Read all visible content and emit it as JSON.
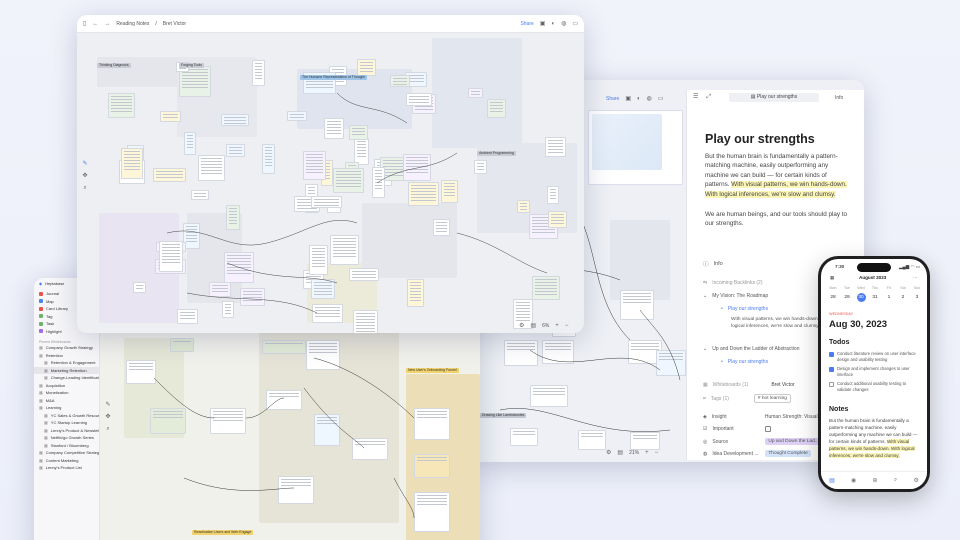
{
  "back_window": {
    "toolbar": {
      "share_label": "Share",
      "zoom": "21%"
    },
    "panel": {
      "toolbar_title": "Play our strengths",
      "info_tab": "Info",
      "title": "Play our strengths",
      "paragraph1": "But the human brain is fundamentally a pattern-matching machine, easily outperforming any machine we can build — for certain kinds of patterns.",
      "paragraph1_highlight": "With visual patterns, we win hands-down. With logical inferences, we're slow and clumsy.",
      "paragraph2": "We are human beings, and our tools should play to our strengths.",
      "info_label": "Info",
      "backlinks_label": "Incoming Backlinks (2)",
      "backlinks": [
        {
          "title": "My Vision: The Roadmap",
          "link": "Play our strengths",
          "text": "With visual patterns, we win hands-down. With logical inferences, we're slow and clumsy."
        },
        {
          "title": "Up and Down the Ladder of Abstraction",
          "link": "Play our strengths"
        }
      ],
      "whiteboards_label": "Whiteboards (1)",
      "author": "Bret Victor",
      "tags_label": "Tags (1)",
      "tag": "# hot learning",
      "props": [
        {
          "key": "Insight",
          "value": "Human Strength: Visual"
        },
        {
          "key": "Important",
          "value": ""
        },
        {
          "key": "Source",
          "value": "Up and Down the Lad..."
        },
        {
          "key": "Idea Development ...",
          "value": "Thought Complete"
        }
      ]
    },
    "canvas_labels": [
      "Drawing Like Lambdanotes"
    ]
  },
  "left_window": {
    "sidebar": {
      "title": "Heptabase",
      "items": [
        {
          "label": "Journal",
          "color": "#e8534a"
        },
        {
          "label": "Map",
          "color": "#4a86e8"
        },
        {
          "label": "Card Library",
          "color": "#e8534a"
        },
        {
          "label": "Tag",
          "color": "#6bb36b"
        },
        {
          "label": "Task",
          "color": "#6bb36b"
        },
        {
          "label": "Highlight",
          "color": "#a36be8"
        }
      ],
      "section_label": "Pinned Whiteboards",
      "boards": [
        {
          "label": "Company Growth Strategy",
          "level": 0
        },
        {
          "label": "Retention",
          "level": 0
        },
        {
          "label": "Retention & Engagement",
          "level": 1
        },
        {
          "label": "Marketing Retention",
          "level": 1,
          "selected": true
        },
        {
          "label": "Change-Leading Identification T...",
          "level": 1
        },
        {
          "label": "Acquisition",
          "level": 0
        },
        {
          "label": "Monetization",
          "level": 0
        },
        {
          "label": "M&A",
          "level": 0
        },
        {
          "label": "Learning",
          "level": 0
        },
        {
          "label": "YC Sales & Growth Resources",
          "level": 1
        },
        {
          "label": "YC Startup Learning",
          "level": 1
        },
        {
          "label": "Lenny's Product & Newsletter",
          "level": 1
        },
        {
          "label": "Netflix/go Growth Series",
          "level": 1
        },
        {
          "label": "Stanford / Bloomberg",
          "level": 1
        },
        {
          "label": "Company Competitive Strategy",
          "level": 0
        },
        {
          "label": "Content Marketing",
          "level": 0
        },
        {
          "label": "Lenny's Product List",
          "level": 0
        }
      ]
    },
    "canvas_labels": [
      "New User's Onboarding Funnel",
      "Reactivation Users and Web Engage"
    ]
  },
  "front_window": {
    "toolbar": {
      "breadcrumb1": "Reading Notes",
      "breadcrumb2": "Bret Victor",
      "share_label": "Share",
      "zoom": "6%"
    },
    "sections": [
      {
        "label": "Thinking Diagnosis"
      },
      {
        "label": "Forging Tools"
      },
      {
        "label": "The Humane Representation of Thought"
      },
      {
        "label": "Ambient Programming"
      }
    ]
  },
  "phone": {
    "time": "7:30",
    "month": "August 2023",
    "weekdays": [
      "Mon",
      "Tue",
      "Wed",
      "Thu",
      "Fri",
      "Sat",
      "Sun"
    ],
    "days": [
      "28",
      "29",
      "30",
      "31",
      "1",
      "2",
      "3"
    ],
    "weekday_label": "WEDNESDAY",
    "date_title": "Aug 30, 2023",
    "todos_title": "Todos",
    "todos": [
      {
        "text": "Conduct literature review on user interface design and usability testing",
        "done": true
      },
      {
        "text": "Design and implement changes to user interface",
        "done": true
      },
      {
        "text": "Conduct additional usability testing to validate changes",
        "done": false
      }
    ],
    "notes_title": "Notes",
    "notes": "But the human brain is fundamentally a pattern-matching machine, easily outperforming any machine we can build — for certain kinds of patterns.",
    "notes_highlight": "With visual patterns, we win hands-down. With logical inferences, we're slow and clumsy."
  },
  "colors": {
    "accent": "#4a7cf0",
    "highlight": "#fbf5b6",
    "purple_tag": "#ddd0f5",
    "blue_tag": "#d2e2f8"
  }
}
